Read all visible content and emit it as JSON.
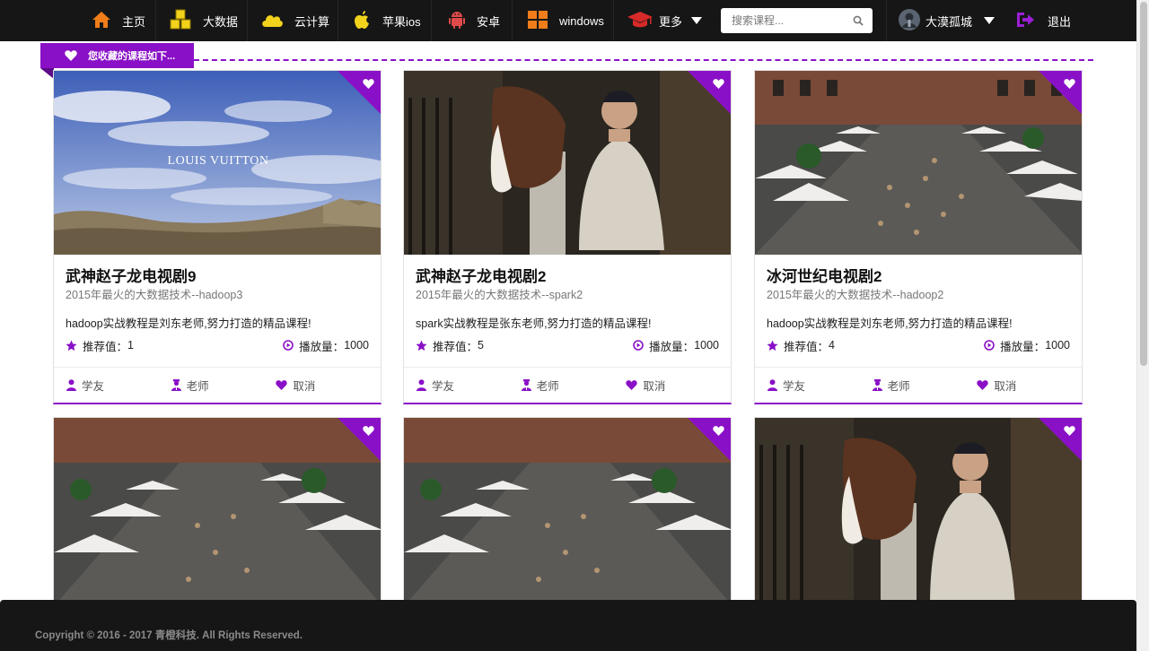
{
  "nav": {
    "items": [
      {
        "label": "主页",
        "icon": "home-icon"
      },
      {
        "label": "大数据",
        "icon": "cubes-icon"
      },
      {
        "label": "云计算",
        "icon": "cloud-icon"
      },
      {
        "label": "苹果ios",
        "icon": "apple-icon"
      },
      {
        "label": "安卓",
        "icon": "android-icon"
      },
      {
        "label": "windows",
        "icon": "windows-icon"
      }
    ],
    "more": {
      "label": "更多",
      "icon": "graduation-cap-icon"
    },
    "search_placeholder": "搜索课程...",
    "user_name": "大漠孤城",
    "logout_label": "退出"
  },
  "section": {
    "title": "您收藏的课程如下..."
  },
  "cards": [
    {
      "title": "武神赵子龙电视剧9",
      "subtitle": "2015年最火的大数据技术--hadoop3",
      "desc": "hadoop实战教程是刘东老师,努力打造的精品课程!",
      "rec_label": "推荐值：",
      "rec_value": "1",
      "play_label": "播放量：",
      "play_value": "1000",
      "classmate": "学友",
      "teacher": "老师",
      "cancel": "取消",
      "image": "sky-desert-logo",
      "image_text": "LOUIS VUITTON"
    },
    {
      "title": "武神赵子龙电视剧2",
      "subtitle": "2015年最火的大数据技术--spark2",
      "desc": "spark实战教程是张东老师,努力打造的精品课程!",
      "rec_label": "推荐值：",
      "rec_value": "5",
      "play_label": "播放量：",
      "play_value": "1000",
      "classmate": "学友",
      "teacher": "老师",
      "cancel": "取消",
      "image": "man-with-horse"
    },
    {
      "title": "冰河世纪电视剧2",
      "subtitle": "2015年最火的大数据技术--hadoop2",
      "desc": "hadoop实战教程是刘东老师,努力打造的精品课程!",
      "rec_label": "推荐值：",
      "rec_value": "4",
      "play_label": "播放量：",
      "play_value": "1000",
      "classmate": "学友",
      "teacher": "老师",
      "cancel": "取消",
      "image": "street-market"
    },
    {
      "image": "street-market"
    },
    {
      "image": "street-market"
    },
    {
      "image": "man-with-horse"
    }
  ],
  "footer": {
    "copyright": "Copyright © 2016 - 2017 青橙科技. All Rights Reserved."
  },
  "colors": {
    "accent": "#8a10c7",
    "topbar": "#161616"
  }
}
